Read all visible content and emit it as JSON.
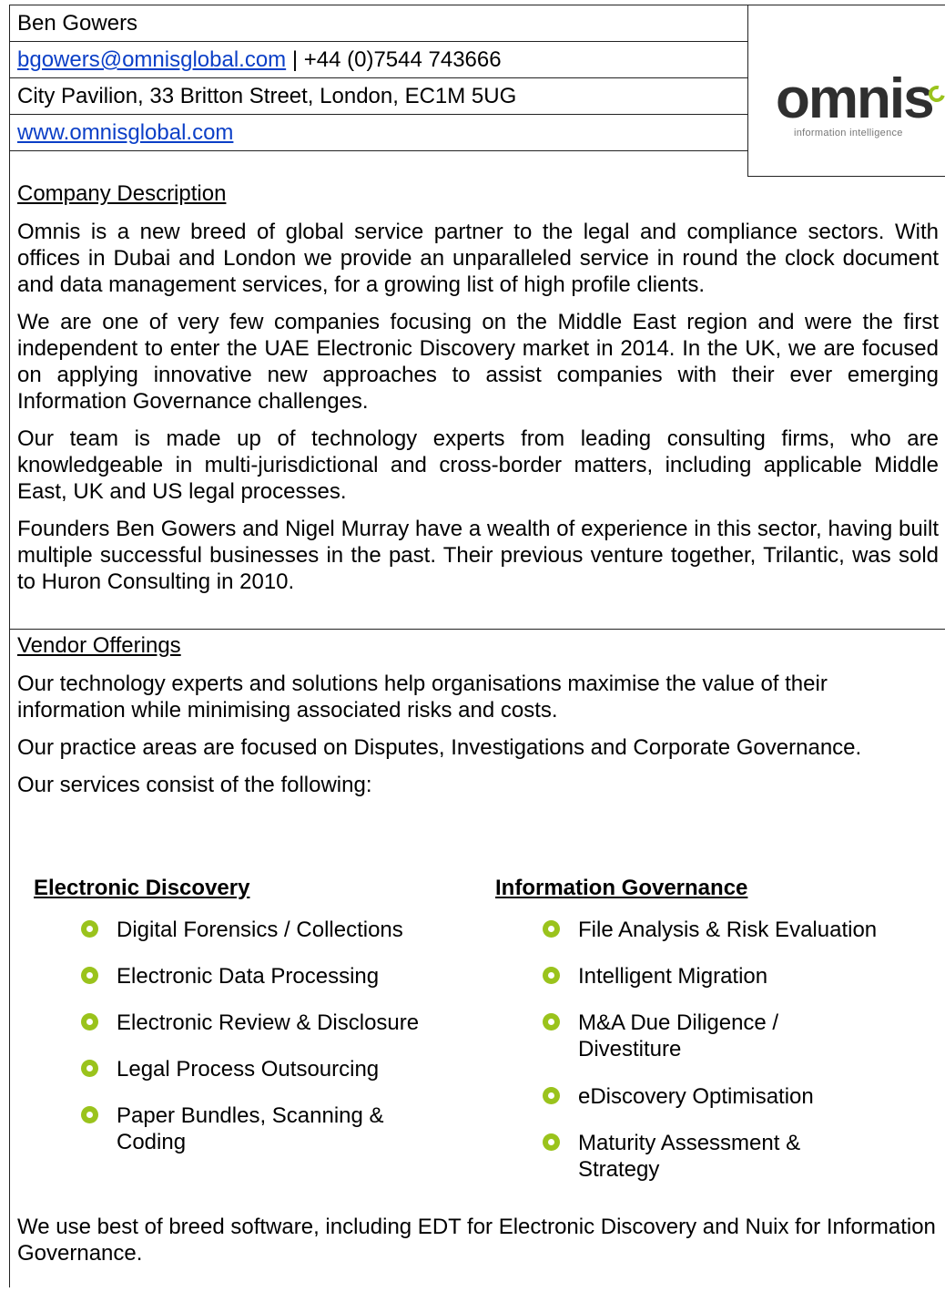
{
  "header": {
    "name": "Ben Gowers",
    "email": "bgowers@omnisglobal.com",
    "phone_sep": " | +44 (0)7544 743666",
    "address": "City Pavilion, 33 Britton Street, London, EC1M 5UG",
    "website": "www.omnisglobal.com",
    "logo": {
      "word": "omnis",
      "tagline": "information intelligence",
      "accent_color": "#9ac31c"
    }
  },
  "company": {
    "title": "Company Description",
    "paragraphs": [
      "Omnis is a new breed of global service partner to the legal and compliance sectors. With offices in Dubai and London we provide an unparalleled service in round the clock document and data management services, for a growing list of high profile clients.",
      "We are one of very few companies focusing on the Middle East region and were the first independent to enter the UAE Electronic Discovery market in 2014.  In the UK, we are focused on applying innovative new approaches to assist companies with their ever emerging Information Governance challenges.",
      "Our team is made up of technology experts from leading consulting firms, who are knowledgeable in multi-jurisdictional and cross-border matters, including applicable Middle East, UK and US legal processes.",
      "Founders Ben Gowers and Nigel Murray have a wealth of experience in this sector, having built multiple successful businesses in the past.  Their previous venture together, Trilantic, was sold to Huron Consulting in 2010."
    ]
  },
  "vendor": {
    "title": "Vendor Offerings",
    "p1": "Our technology experts and solutions help organisations maximise the value of their information while minimising associated risks and costs.",
    "p2": "Our practice areas are focused on Disputes, Investigations and Corporate Governance.",
    "p3": "Our services consist of the following:",
    "left_heading": "Electronic Discovery",
    "left_items": [
      "Digital Forensics / Collections",
      "Electronic Data Processing",
      "Electronic Review & Disclosure",
      "Legal Process Outsourcing",
      "Paper Bundles, Scanning & Coding"
    ],
    "right_heading": "Information Governance",
    "right_items": [
      "File Analysis & Risk Evaluation",
      "Intelligent Migration",
      "M&A Due Diligence / Divestiture",
      "eDiscovery Optimisation",
      "Maturity Assessment & Strategy"
    ],
    "closing": "We use best of breed software, including EDT for Electronic Discovery and Nuix for Information Governance."
  }
}
